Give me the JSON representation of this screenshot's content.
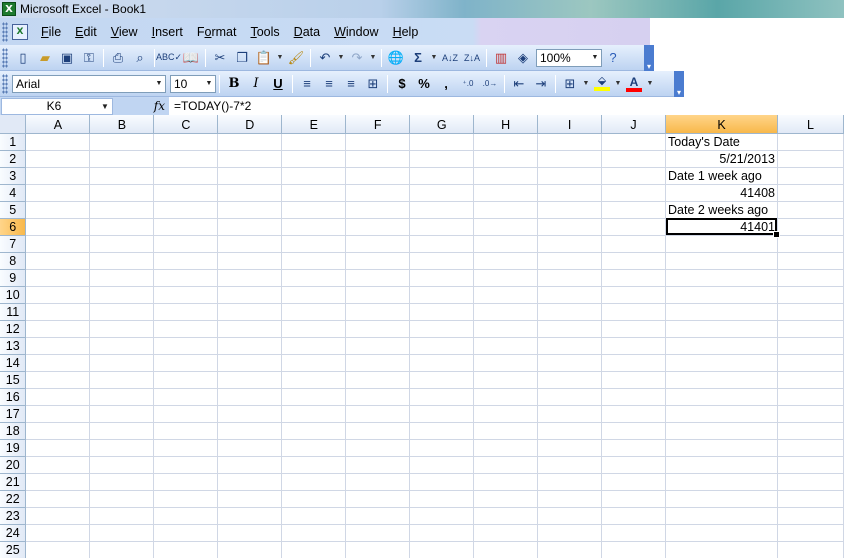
{
  "window": {
    "title": "Microsoft Excel - Book1",
    "icon": "excel-icon"
  },
  "menu": [
    {
      "label": "File",
      "mnemonic": "F",
      "rest": "ile"
    },
    {
      "label": "Edit",
      "mnemonic": "E",
      "rest": "dit"
    },
    {
      "label": "View",
      "mnemonic": "V",
      "rest": "iew"
    },
    {
      "label": "Insert",
      "mnemonic": "I",
      "rest": "nsert"
    },
    {
      "label": "Format",
      "mnemonic": "",
      "pre": "F",
      "mn2": "o",
      "post": "rmat"
    },
    {
      "label": "Tools",
      "mnemonic": "T",
      "rest": "ools"
    },
    {
      "label": "Data",
      "mnemonic": "D",
      "rest": "ata"
    },
    {
      "label": "Window",
      "mnemonic": "W",
      "rest": "indow"
    },
    {
      "label": "Help",
      "mnemonic": "H",
      "rest": "elp"
    }
  ],
  "standard_toolbar": {
    "zoom": "100%",
    "icons": [
      "new-icon",
      "open-icon",
      "save-icon",
      "permission-icon",
      "print-icon",
      "print-preview-icon",
      "spelling-icon",
      "research-icon",
      "cut-icon",
      "copy-icon",
      "paste-icon",
      "format-painter-icon",
      "undo-icon",
      "redo-icon",
      "hyperlink-icon",
      "autosum-icon",
      "sort-ascending-icon",
      "sort-descending-icon",
      "chart-wizard-icon",
      "drawing-icon",
      "help-icon"
    ]
  },
  "formatting_toolbar": {
    "font": "Arial",
    "size": "10",
    "bold": "B",
    "italic": "I",
    "underline": "U",
    "currency": "$",
    "percent": "%",
    "comma": ",",
    "font_color": "#ff0000",
    "fill_color": "#ffff00"
  },
  "formula_bar": {
    "name_box": "K6",
    "fx": "fx",
    "formula": "=TODAY()-7*2"
  },
  "grid": {
    "columns": [
      "A",
      "B",
      "C",
      "D",
      "E",
      "F",
      "G",
      "H",
      "I",
      "J",
      "K",
      "L"
    ],
    "rows": [
      "1",
      "2",
      "3",
      "4",
      "5",
      "6",
      "7",
      "8",
      "9",
      "10",
      "11",
      "12",
      "13",
      "14",
      "15",
      "16",
      "17",
      "18",
      "19",
      "20",
      "21",
      "22",
      "23",
      "24",
      "25"
    ],
    "selected_column": "K",
    "selected_row": "6",
    "cells": {
      "K1": "Today's Date",
      "K2": "5/21/2013",
      "K3": "Date 1 week ago",
      "K4": "41408",
      "K5": "Date 2 weeks ago",
      "K6": "41401"
    }
  }
}
